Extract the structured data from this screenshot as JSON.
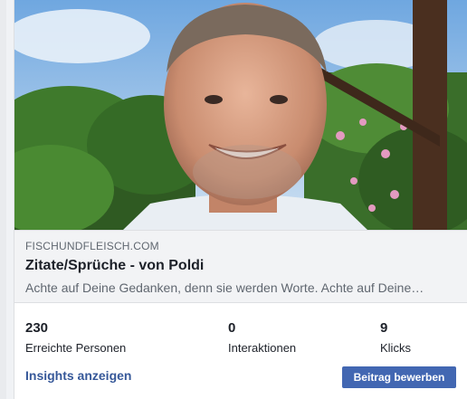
{
  "link_preview": {
    "domain": "FISCHUNDFLEISCH.COM",
    "title": "Zitate/Sprüche - von Poldi",
    "description": "Achte auf Deine Gedanken, denn sie werden Worte. Achte auf Deine…"
  },
  "stats": [
    {
      "value": "230",
      "label": "Erreichte Personen"
    },
    {
      "value": "0",
      "label": "Interaktionen"
    },
    {
      "value": "9",
      "label": "Klicks"
    }
  ],
  "actions": {
    "insights_label": "Insights anzeigen",
    "boost_label": "Beitrag bewerben"
  },
  "colors": {
    "link_blue": "#365899",
    "button_blue": "#4267b2"
  }
}
